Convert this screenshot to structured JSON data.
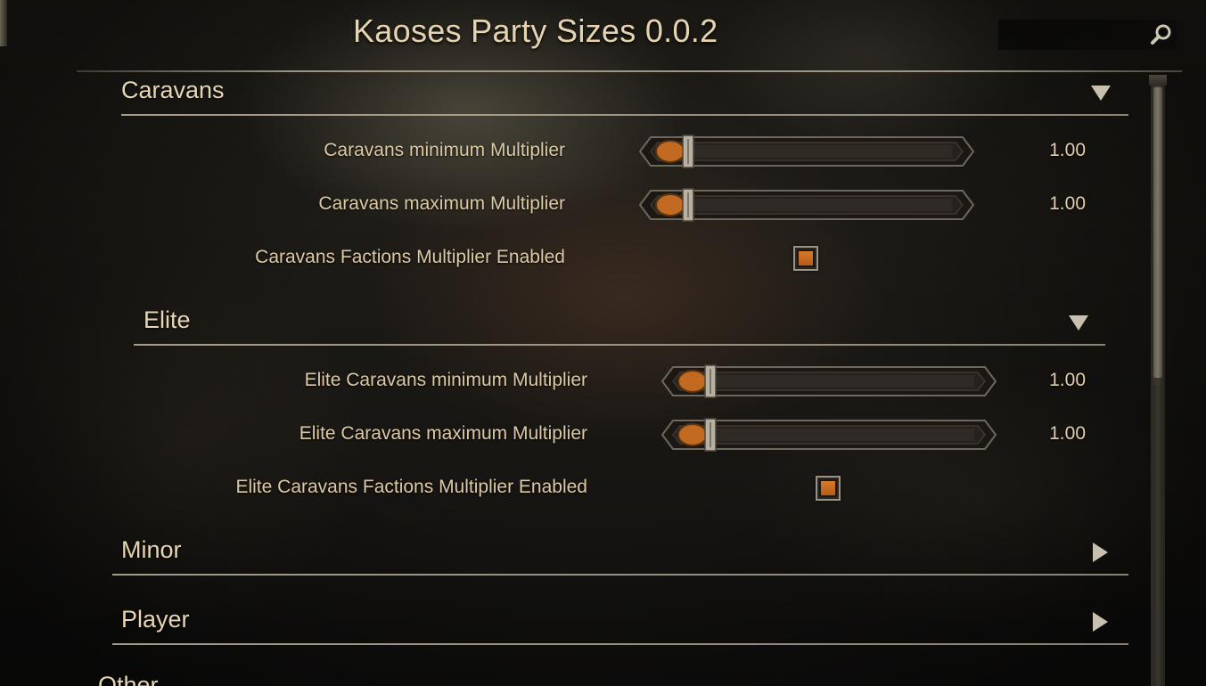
{
  "window": {
    "title": "Kaoses Party Sizes 0.0.2"
  },
  "search": {
    "placeholder": ""
  },
  "icons": {
    "search": "search-icon",
    "expanded": "triangle-down-icon",
    "collapsed": "triangle-right-icon"
  },
  "colors": {
    "accent": "#c8691f",
    "text": "#e0cfae",
    "divider": "#bdb29c"
  },
  "caravans": {
    "label": "Caravans",
    "expanded": true,
    "options": {
      "min_label": "Caravans minimum Multiplier",
      "min_value": "1.00",
      "min_fraction": 0.0,
      "max_label": "Caravans maximum Multiplier",
      "max_value": "1.00",
      "max_fraction": 0.0,
      "factions_label": "Caravans Factions Multiplier Enabled",
      "factions_checked": true
    },
    "elite": {
      "label": "Elite",
      "expanded": true,
      "min_label": "Elite Caravans minimum Multiplier",
      "min_value": "1.00",
      "min_fraction": 0.0,
      "max_label": "Elite Caravans maximum Multiplier",
      "max_value": "1.00",
      "max_fraction": 0.0,
      "factions_label": "Elite Caravans Factions Multiplier Enabled",
      "factions_checked": true
    }
  },
  "minor": {
    "label": "Minor",
    "expanded": false
  },
  "player": {
    "label": "Player",
    "expanded": false
  },
  "other": {
    "label": "Other",
    "expanded": false
  }
}
